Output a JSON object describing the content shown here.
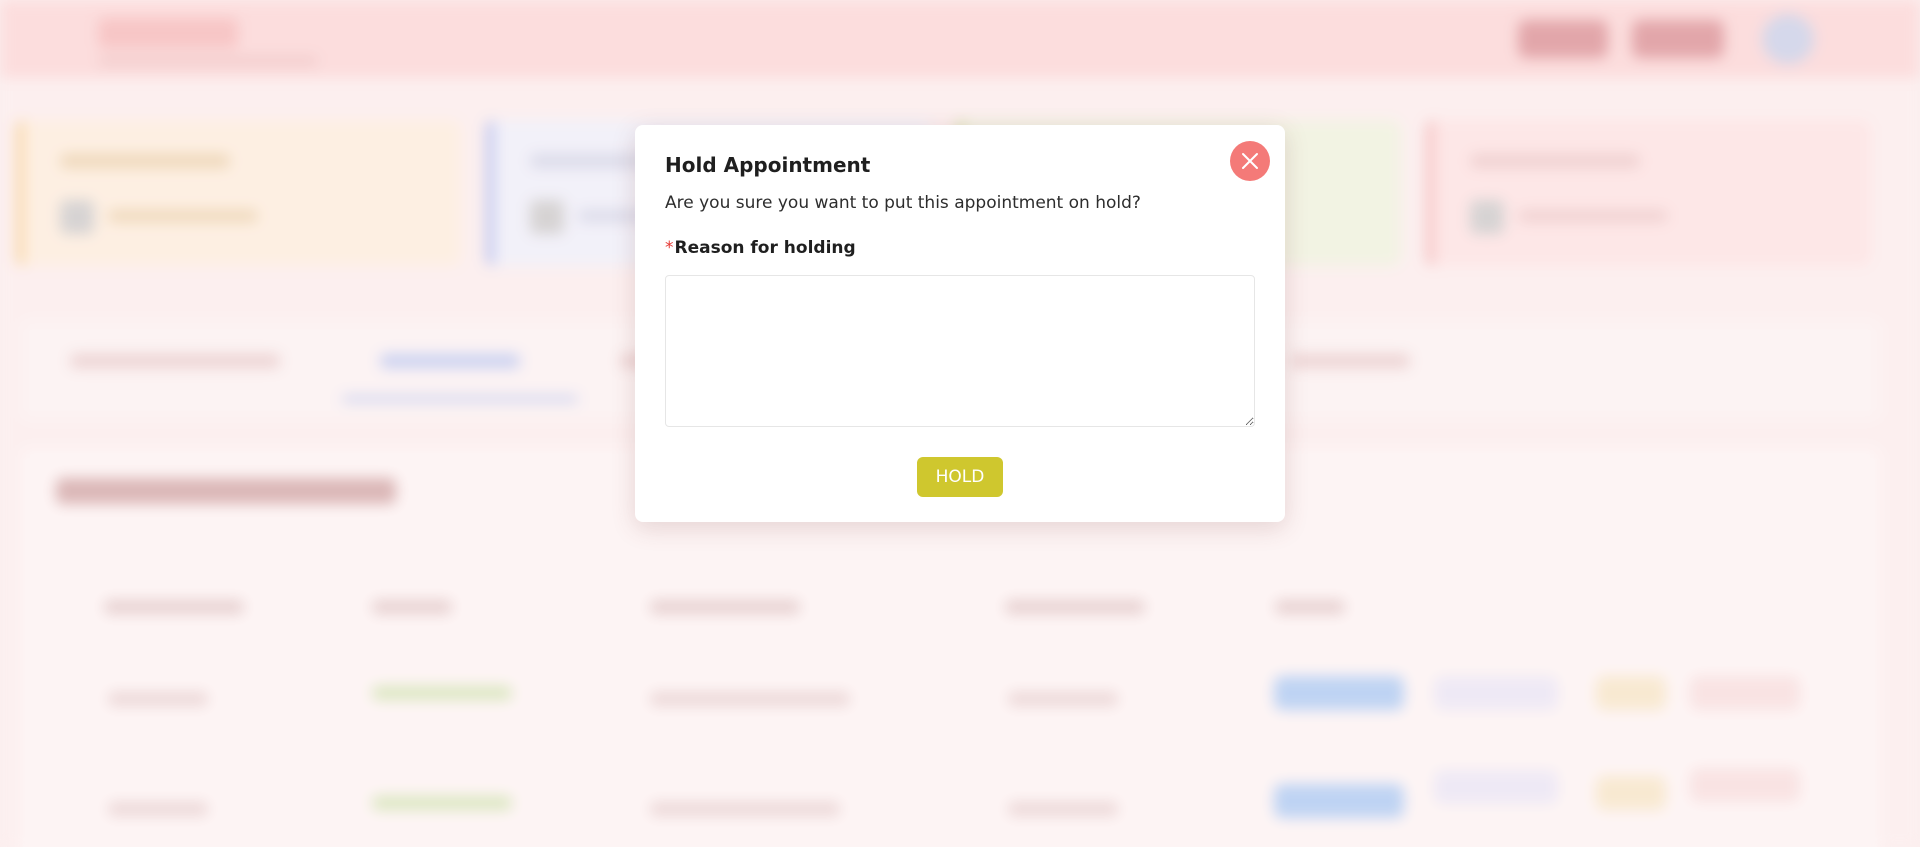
{
  "modal": {
    "title": "Hold Appointment",
    "message": "Are you sure you want to put this appointment on hold?",
    "required_marker": "*",
    "reason_label": "Reason for holding",
    "reason_value": "",
    "hold_button_label": "HOLD",
    "close_icon": "close-icon"
  },
  "colors": {
    "close_button": "#f47a78",
    "hold_button": "#cfc72e",
    "required_marker": "#e53935",
    "header_bg": "#fbd6d6"
  }
}
